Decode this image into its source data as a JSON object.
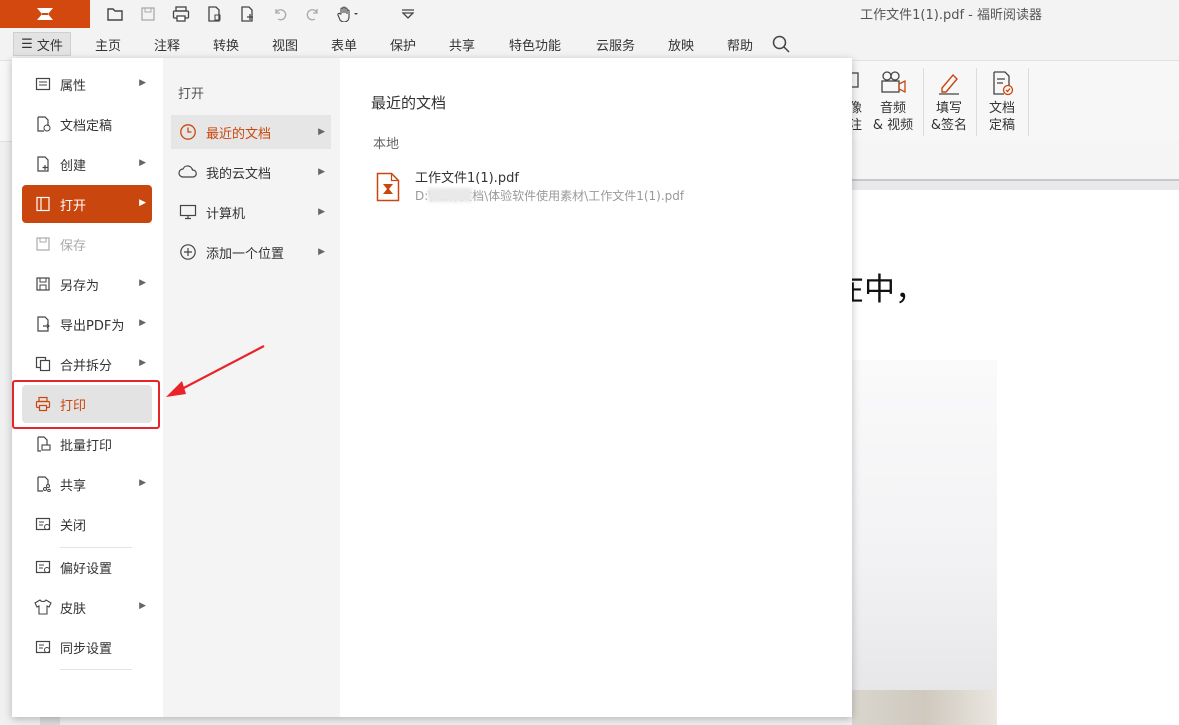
{
  "window": {
    "title": "工作文件1(1).pdf - 福昕阅读器"
  },
  "menu": {
    "file_label": "文件",
    "tabs": [
      "主页",
      "注释",
      "转换",
      "视图",
      "表单",
      "保护",
      "共享",
      "特色功能",
      "云服务",
      "放映",
      "帮助"
    ]
  },
  "ribbon": {
    "partial_label_top": "像",
    "partial_label_bottom": "注",
    "buttons": [
      {
        "line1": "音频",
        "line2": "& 视频",
        "icon": "video-icon"
      },
      {
        "line1": "填写",
        "line2": "&签名",
        "icon": "pen-icon"
      },
      {
        "line1": "文档",
        "line2": "定稿",
        "icon": "doc-check-icon"
      }
    ]
  },
  "file_menu": {
    "items": [
      {
        "label": "属性",
        "icon": "properties-icon",
        "submenu": true
      },
      {
        "label": "文档定稿",
        "icon": "doc-final-icon",
        "submenu": false
      },
      {
        "label": "创建",
        "icon": "create-icon",
        "submenu": true
      },
      {
        "label": "打开",
        "icon": "open-icon",
        "submenu": true,
        "active": true
      },
      {
        "label": "保存",
        "icon": "save-icon",
        "submenu": false,
        "disabled": true
      },
      {
        "label": "另存为",
        "icon": "save-as-icon",
        "submenu": true
      },
      {
        "label": "导出PDF为",
        "icon": "export-icon",
        "submenu": true
      },
      {
        "label": "合并拆分",
        "icon": "merge-icon",
        "submenu": true
      },
      {
        "label": "打印",
        "icon": "print-icon",
        "submenu": false,
        "highlighted": true
      },
      {
        "label": "批量打印",
        "icon": "batch-print-icon",
        "submenu": false
      },
      {
        "label": "共享",
        "icon": "share-icon",
        "submenu": true
      },
      {
        "label": "关闭",
        "icon": "close-doc-icon",
        "submenu": false
      },
      {
        "label": "偏好设置",
        "icon": "preferences-icon",
        "submenu": false
      },
      {
        "label": "皮肤",
        "icon": "skin-icon",
        "submenu": true
      },
      {
        "label": "同步设置",
        "icon": "sync-icon",
        "submenu": false
      }
    ]
  },
  "open_panel": {
    "title": "打开",
    "items": [
      {
        "label": "最近的文档",
        "icon": "clock-icon",
        "selected": true
      },
      {
        "label": "我的云文档",
        "icon": "cloud-icon"
      },
      {
        "label": "计算机",
        "icon": "computer-icon"
      },
      {
        "label": "添加一个位置",
        "icon": "add-location-icon"
      }
    ]
  },
  "recent": {
    "title": "最近的文档",
    "section": "本地",
    "files": [
      {
        "name": "工作文件1(1).pdf",
        "path": "D:\\        工作文档\\体验软件使用素材\\工作文件1(1).pdf"
      }
    ]
  },
  "document": {
    "visible_text": "在中，"
  },
  "colors": {
    "accent": "#c9470e",
    "annotation": "#e8242a"
  }
}
